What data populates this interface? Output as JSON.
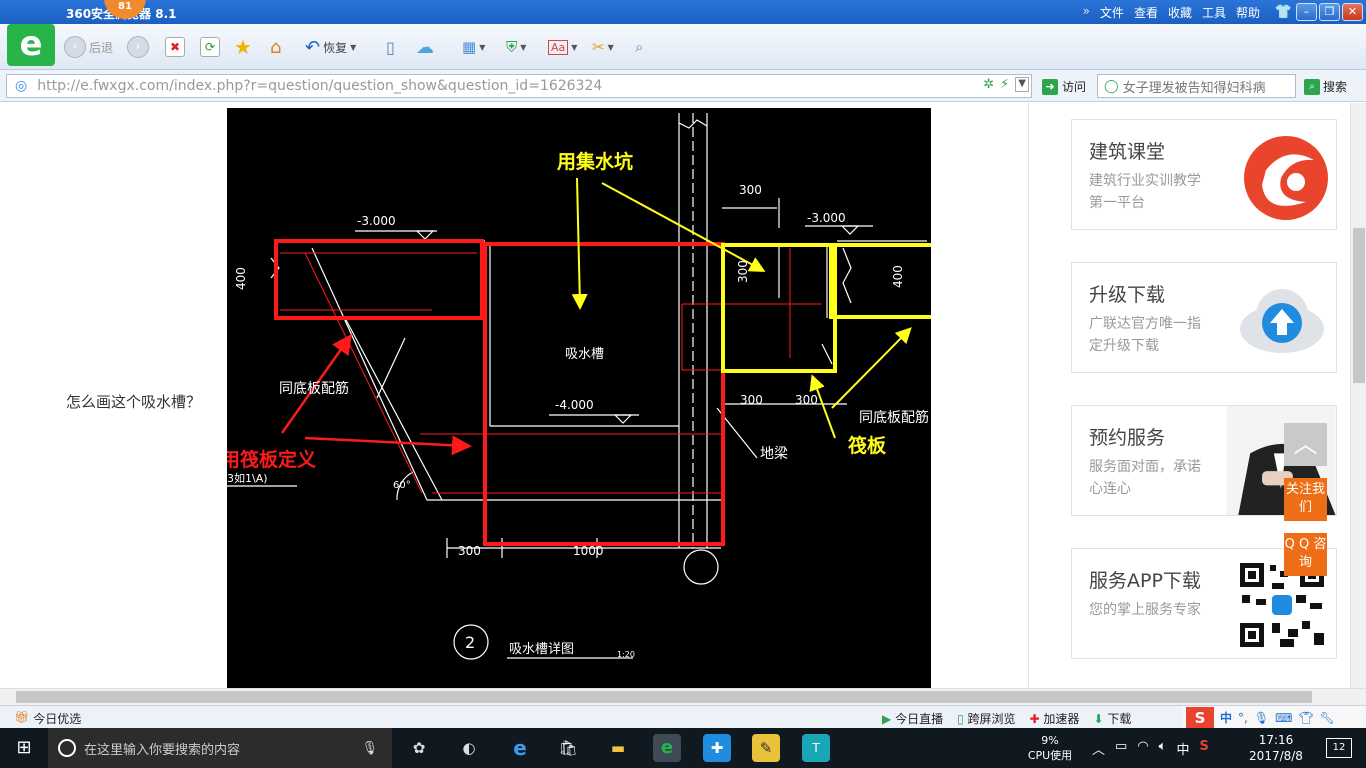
{
  "browser": {
    "title": "360安全浏览器 8.1",
    "badge": "81",
    "menu": [
      "文件",
      "查看",
      "收藏",
      "工具",
      "帮助"
    ],
    "back_label": "后退",
    "restore_label": "恢复",
    "url": "http://e.fwxgx.com/index.php?r=question/question_show&question_id=1626324",
    "visit_label": "访问",
    "search_placeholder": "女子理发被告知得妇科病",
    "search_label": "搜索"
  },
  "page": {
    "question": "怎么画这个吸水槽？"
  },
  "drawing": {
    "dims": {
      "elev_left": "-3.000",
      "elev_right": "-3.000",
      "elev_bottom": "-4.000",
      "dim_400_left": "400",
      "dim_400_right": "400",
      "dim_300_top": "300",
      "dim_300_side": "300",
      "dim_300_a": "300",
      "dim_300_b": "300",
      "dim_300_bottom": "300",
      "dim_1000": "1000",
      "angle": "60°"
    },
    "labels": {
      "sump": "吸水槽",
      "same_reinf_left": "同底板配筋",
      "same_reinf_right": "同底板配筋",
      "ground_beam": "地梁",
      "note_left": "3如1\\A)",
      "detail_no": "2",
      "detail_title": "吸水槽详图",
      "scale": "1:20"
    },
    "annotations": {
      "pit": "用集水坑",
      "raft_def": "用筏板定义",
      "raft": "筏板"
    },
    "colors": {
      "background": "#000000",
      "red": "#ff1a1a",
      "yellow": "#ffff1a",
      "line": "#ffffff"
    }
  },
  "sidebar": {
    "cards": [
      {
        "title": "建筑课堂",
        "subtitle": "建筑行业实训教学第一平台",
        "icon": "orange-logo-icon"
      },
      {
        "title": "升级下载",
        "subtitle": "广联达官方唯一指定升级下载",
        "icon": "cloud-upload-icon"
      },
      {
        "title": "预约服务",
        "subtitle": "服务面对面，承诺心连心",
        "icon": "businessman-photo"
      },
      {
        "title": "服务APP下载",
        "subtitle": "您的掌上服务专家",
        "icon": "qr-code-icon"
      }
    ],
    "follow_label": "关注我们",
    "qq_label": "Q Q 咨询"
  },
  "statusbar": {
    "today": "今日优选",
    "live": "今日直播",
    "cross_screen": "跨屏浏览",
    "accelerator": "加速器",
    "download": "下载",
    "ime_lang": "中"
  },
  "taskbar": {
    "search_placeholder": "在这里输入你要搜索的内容",
    "cpu_percent": "9%",
    "cpu_label": "CPU使用",
    "tray_lang": "中",
    "time": "17:16",
    "date": "2017/8/8",
    "notifications": "12"
  }
}
